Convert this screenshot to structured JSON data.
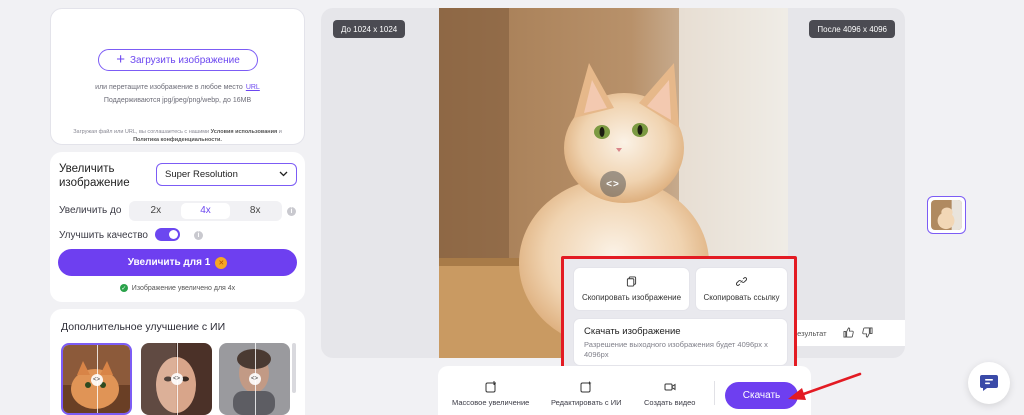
{
  "upload": {
    "button_label": "Загрузить изображение",
    "drag_text": "или перетащите изображение в любое место",
    "url_link": "URL",
    "formats_text": "Поддерживаются jpg/jpeg/png/webp, до 16MB",
    "terms_prefix": "Загружая файл или URL, вы соглашаетесь с нашими",
    "terms_link": "Условия использования",
    "terms_and": "и",
    "privacy_link": "Политика конфиденциальности."
  },
  "settings": {
    "title": "Увеличить изображение",
    "model_select": "Super Resolution",
    "scale_label": "Увеличить до",
    "scale_options": [
      "2x",
      "4x",
      "8x"
    ],
    "scale_selected": "4x",
    "quality_label": "Улучшить качество",
    "upscale_button": "Увеличить для 1",
    "status_text": "Изображение увеличено для 4x"
  },
  "ai": {
    "title": "Дополнительное улучшение с ИИ"
  },
  "preview": {
    "before_tag": "До 1024 x 1024",
    "after_tag": "После 4096 x 4096",
    "feedback_label": "результат"
  },
  "popup": {
    "copy_image": "Скопировать изображение",
    "copy_link": "Скопировать ссылку",
    "download_title": "Скачать изображение",
    "download_desc": "Разрешение выходного изображения будет 4096px x 4096px"
  },
  "bottombar": {
    "batch": "Массовое увеличение",
    "edit_ai": "Редактировать с ИИ",
    "make_video": "Создать видео",
    "download": "Скачать"
  },
  "colors": {
    "accent": "#6e3ff0",
    "highlight": "#e31b23"
  }
}
